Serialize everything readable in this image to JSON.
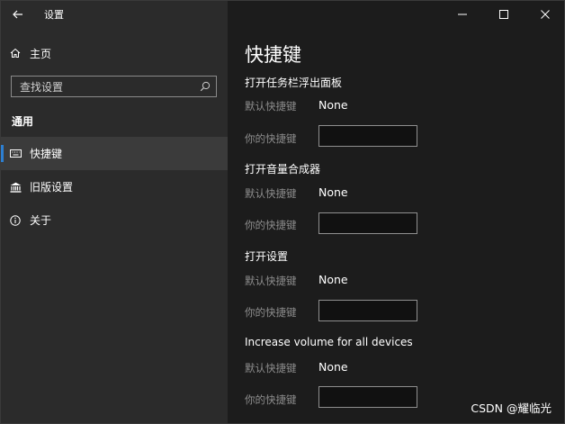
{
  "window": {
    "title": "设置"
  },
  "sidebar": {
    "home_label": "主页",
    "search_placeholder": "查找设置",
    "section_label": "通用",
    "items": [
      {
        "label": "快捷键",
        "icon": "keyboard-icon",
        "selected": true
      },
      {
        "label": "旧版设置",
        "icon": "bank-icon",
        "selected": false
      },
      {
        "label": "关于",
        "icon": "info-icon",
        "selected": false
      }
    ]
  },
  "main": {
    "page_title": "快捷键",
    "groups": [
      {
        "title": "打开任务栏浮出面板",
        "default_label": "默认快捷键",
        "default_value": "None",
        "yours_label": "你的快捷键",
        "yours_value": ""
      },
      {
        "title": "打开音量合成器",
        "default_label": "默认快捷键",
        "default_value": "None",
        "yours_label": "你的快捷键",
        "yours_value": ""
      },
      {
        "title": "打开设置",
        "default_label": "默认快捷键",
        "default_value": "None",
        "yours_label": "你的快捷键",
        "yours_value": ""
      },
      {
        "title": "Increase volume for all devices",
        "default_label": "默认快捷键",
        "default_value": "None",
        "yours_label": "你的快捷键",
        "yours_value": ""
      }
    ]
  },
  "watermark": "CSDN @耀临光",
  "colors": {
    "accent": "#2d7fd1",
    "sidebar_bg": "#2b2b2b",
    "main_bg": "#1c1c1c",
    "selected_bg": "#3b3b3b"
  }
}
